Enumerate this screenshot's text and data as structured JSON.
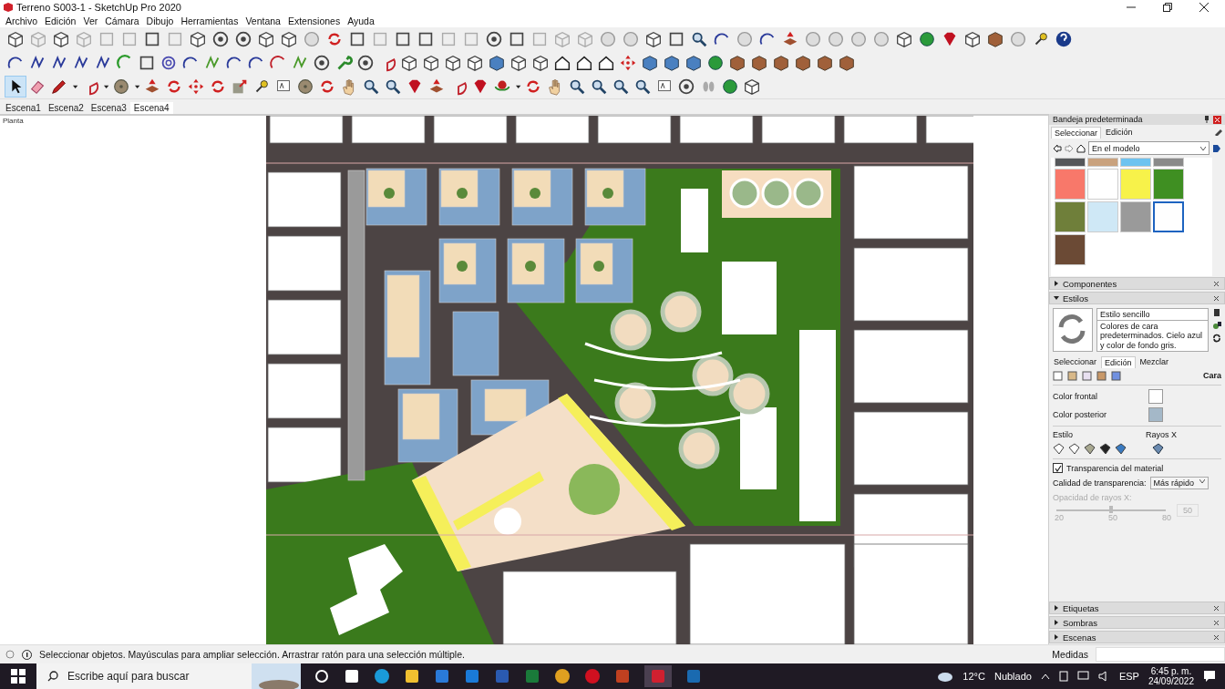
{
  "window": {
    "title": "Terreno S003-1 - SketchUp Pro 2020"
  },
  "menu": [
    "Archivo",
    "Edición",
    "Ver",
    "Cámara",
    "Dibujo",
    "Herramientas",
    "Ventana",
    "Extensiones",
    "Ayuda"
  ],
  "scene_tabs": [
    {
      "label": "Escena1",
      "selected": false
    },
    {
      "label": "Escena2",
      "selected": false
    },
    {
      "label": "Escena3",
      "selected": false
    },
    {
      "label": "Escena4",
      "selected": true
    }
  ],
  "viewport": {
    "label": "Planta"
  },
  "tray": {
    "title": "Bandeja predeterminada",
    "materials": {
      "tabs": [
        {
          "label": "Seleccionar",
          "selected": true
        },
        {
          "label": "Edición",
          "selected": false
        }
      ],
      "collection": "En el modelo",
      "swatches": [
        {
          "color": "#55575a",
          "selected": false
        },
        {
          "color": "#c9a27e",
          "selected": false
        },
        {
          "color": "#6ec3f0",
          "selected": false
        },
        {
          "color": "#8a8a8a",
          "selected": false
        },
        {
          "color": "#f8786a",
          "selected": false
        },
        {
          "color": "#ffffff",
          "selected": false
        },
        {
          "color": "#f7f24a",
          "selected": false
        },
        {
          "color": "#3f8f22",
          "selected": false
        },
        {
          "color": "#6f7f3a",
          "selected": false
        },
        {
          "color": "#cfe8f6",
          "selected": false
        },
        {
          "color": "#9a9a9a",
          "selected": false
        },
        {
          "color": "#fefefe",
          "selected": true
        },
        {
          "color": "#6b4a35",
          "selected": false
        }
      ]
    },
    "sections_top": [
      {
        "label": "Componentes",
        "expanded": false
      },
      {
        "label": "Estilos",
        "expanded": true
      }
    ],
    "styles": {
      "name": "Estilo sencillo",
      "description": "Colores de cara predeterminados. Cielo azul y color de fondo gris.",
      "tabs": [
        {
          "label": "Seleccionar",
          "selected": false
        },
        {
          "label": "Edición",
          "selected": true
        },
        {
          "label": "Mezclar",
          "selected": false
        }
      ],
      "heading": "Cara",
      "face_colors": [
        {
          "label": "Color frontal",
          "color": "#ffffff"
        },
        {
          "label": "Color posterior",
          "color": "#a4b8c8"
        }
      ],
      "style_label": "Estilo",
      "xray_label": "Rayos X",
      "material_transparency": {
        "label": "Transparencia del material",
        "checked": true
      },
      "transparency_quality": {
        "label": "Calidad de transparencia:",
        "value": "Más rápido"
      },
      "xray_opacity": {
        "label": "Opacidad de rayos X:",
        "disabled": true,
        "level": 0.5,
        "ticks": [
          "20",
          "50",
          "80"
        ],
        "value": "50"
      }
    },
    "sections_bottom": [
      {
        "label": "Etiquetas",
        "expanded": false
      },
      {
        "label": "Sombras",
        "expanded": false
      },
      {
        "label": "Escenas",
        "expanded": false
      }
    ]
  },
  "status_bar": {
    "message": "Seleccionar objetos. Mayúsculas para ampliar selección. Arrastrar ratón para una selección múltiple.",
    "measurements_label": "Medidas"
  },
  "taskbar": {
    "search_placeholder": "Escribe aquí para buscar",
    "temperature": "12°C",
    "weather": "Nublado",
    "language": "ESP",
    "time": "6:45 p. m.",
    "date": "24/09/2022"
  }
}
